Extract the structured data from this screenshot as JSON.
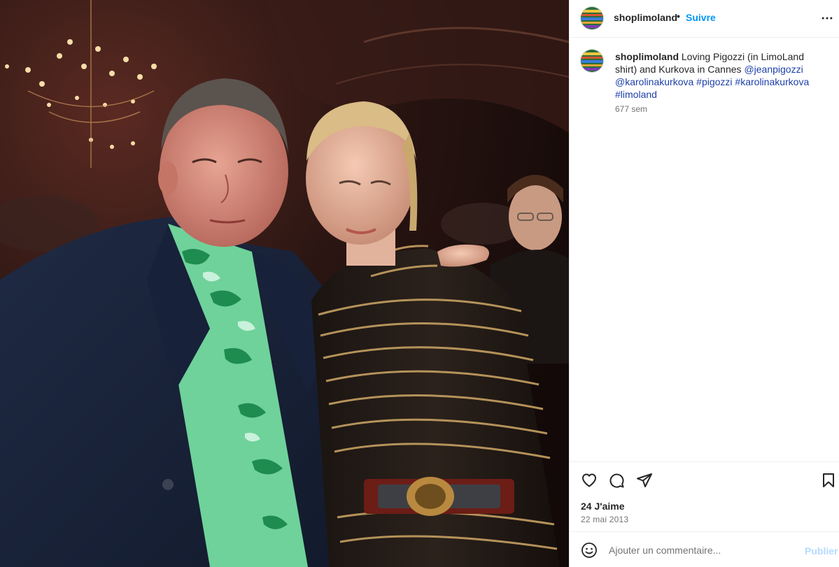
{
  "post": {
    "username": "shoplimoland",
    "separator": "•",
    "follow_label": "Suivre",
    "more_icon": "more-horizontal-icon",
    "caption": {
      "username": "shoplimoland",
      "text_before": "Loving Pigozzi (in LimoLand shirt) and Kurkova in Cannes",
      "tags": [
        "@jeanpigozzi",
        "@karolinakurkova",
        "#pigozzi",
        "#karolinakurkova",
        "#limoland"
      ]
    },
    "time_ago": "677 sem",
    "likes": "24 J'aime",
    "date": "22 mai 2013"
  },
  "actions": {
    "like_icon": "heart-icon",
    "comment_icon": "comment-icon",
    "share_icon": "send-icon",
    "save_icon": "bookmark-icon"
  },
  "comment_bar": {
    "emoji_icon": "smiley-icon",
    "placeholder": "Ajouter un commentaire...",
    "publish_label": "Publier"
  },
  "colors": {
    "link_blue": "#0095f6",
    "tag_blue": "#1d3fa8",
    "muted_text": "#737373",
    "disabled_publish": "#b3dbff"
  }
}
